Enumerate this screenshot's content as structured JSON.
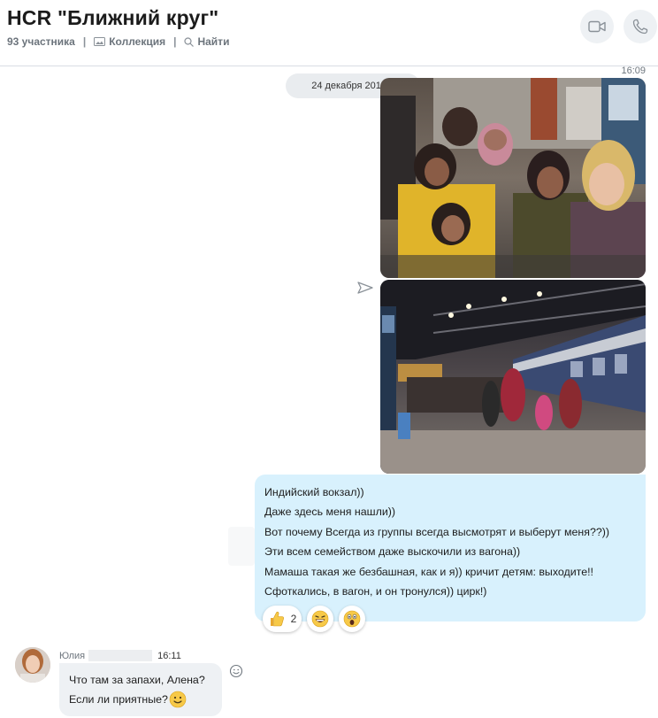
{
  "header": {
    "title": "HCR \"Ближний круг\"",
    "participants": "93 участника",
    "collection_label": "Коллекция",
    "find_label": "Найти",
    "separator": "|",
    "video_call_icon": "video-camera-icon",
    "audio_call_icon": "phone-icon"
  },
  "conversation": {
    "timestamp": "16:09",
    "date_divider": "24 декабря 2019 г.",
    "outgoing_message": {
      "lines": [
        "Индийский вокзал))",
        "Даже здесь меня нашли))",
        "Вот почему Всегда из группы всегда высмотрят и выберут меня??))",
        "Эти всем семейством даже выскочили из вагона))",
        "Мамаша такая же безбашная, как и я)) кричит детям: выходите!!",
        "Сфоткались, в вагон, и он тронулся)) цирк!)"
      ],
      "reactions": [
        {
          "icon": "thumbs-up-emoji",
          "count": "2"
        },
        {
          "icon": "laughing-emoji",
          "count": ""
        },
        {
          "icon": "surprised-emoji",
          "count": ""
        }
      ]
    },
    "incoming_message": {
      "sender": "Юлия",
      "time": "16:11",
      "lines": [
        "Что там за запахи, Алена?",
        "Если ли приятные?"
      ],
      "trailing_icon": "smiley-emoji"
    }
  },
  "colors": {
    "outgoing_bubble": "#d8f1fd",
    "incoming_bubble": "#eef1f4",
    "header_icon": "#8a9198"
  }
}
